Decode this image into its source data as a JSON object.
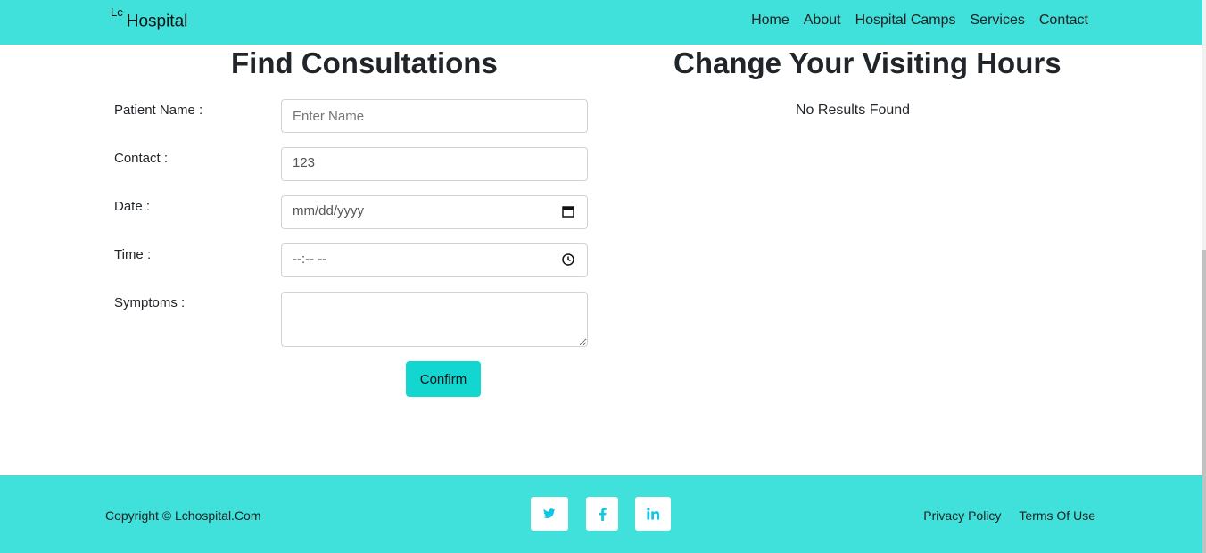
{
  "nav": {
    "brand_sup": "Lc",
    "brand": "Hospital",
    "links": [
      "Home",
      "About",
      "Hospital Camps",
      "Services",
      "Contact"
    ]
  },
  "form": {
    "title": "Find Consultations",
    "name_label": "Patient Name :",
    "name_placeholder": "Enter Name",
    "contact_label": "Contact :",
    "contact_value": "123",
    "date_label": "Date :",
    "date_value": "mm/dd/yyyy",
    "time_label": "Time :",
    "time_value": "--:-- --",
    "symptoms_label": "Symptoms :",
    "confirm": "Confirm"
  },
  "results": {
    "title": "Change Your Visiting Hours",
    "empty_text": "No Results Found"
  },
  "footer": {
    "copyright": "Copyright © Lchospital.Com",
    "social": [
      "twitter-icon",
      "facebook-icon",
      "linkedin-icon"
    ],
    "links": [
      "Privacy Policy",
      "Terms Of Use"
    ]
  },
  "colors": {
    "accent": "#40e0db",
    "button": "#12d6cf",
    "social_icon": "#10c6e6"
  }
}
